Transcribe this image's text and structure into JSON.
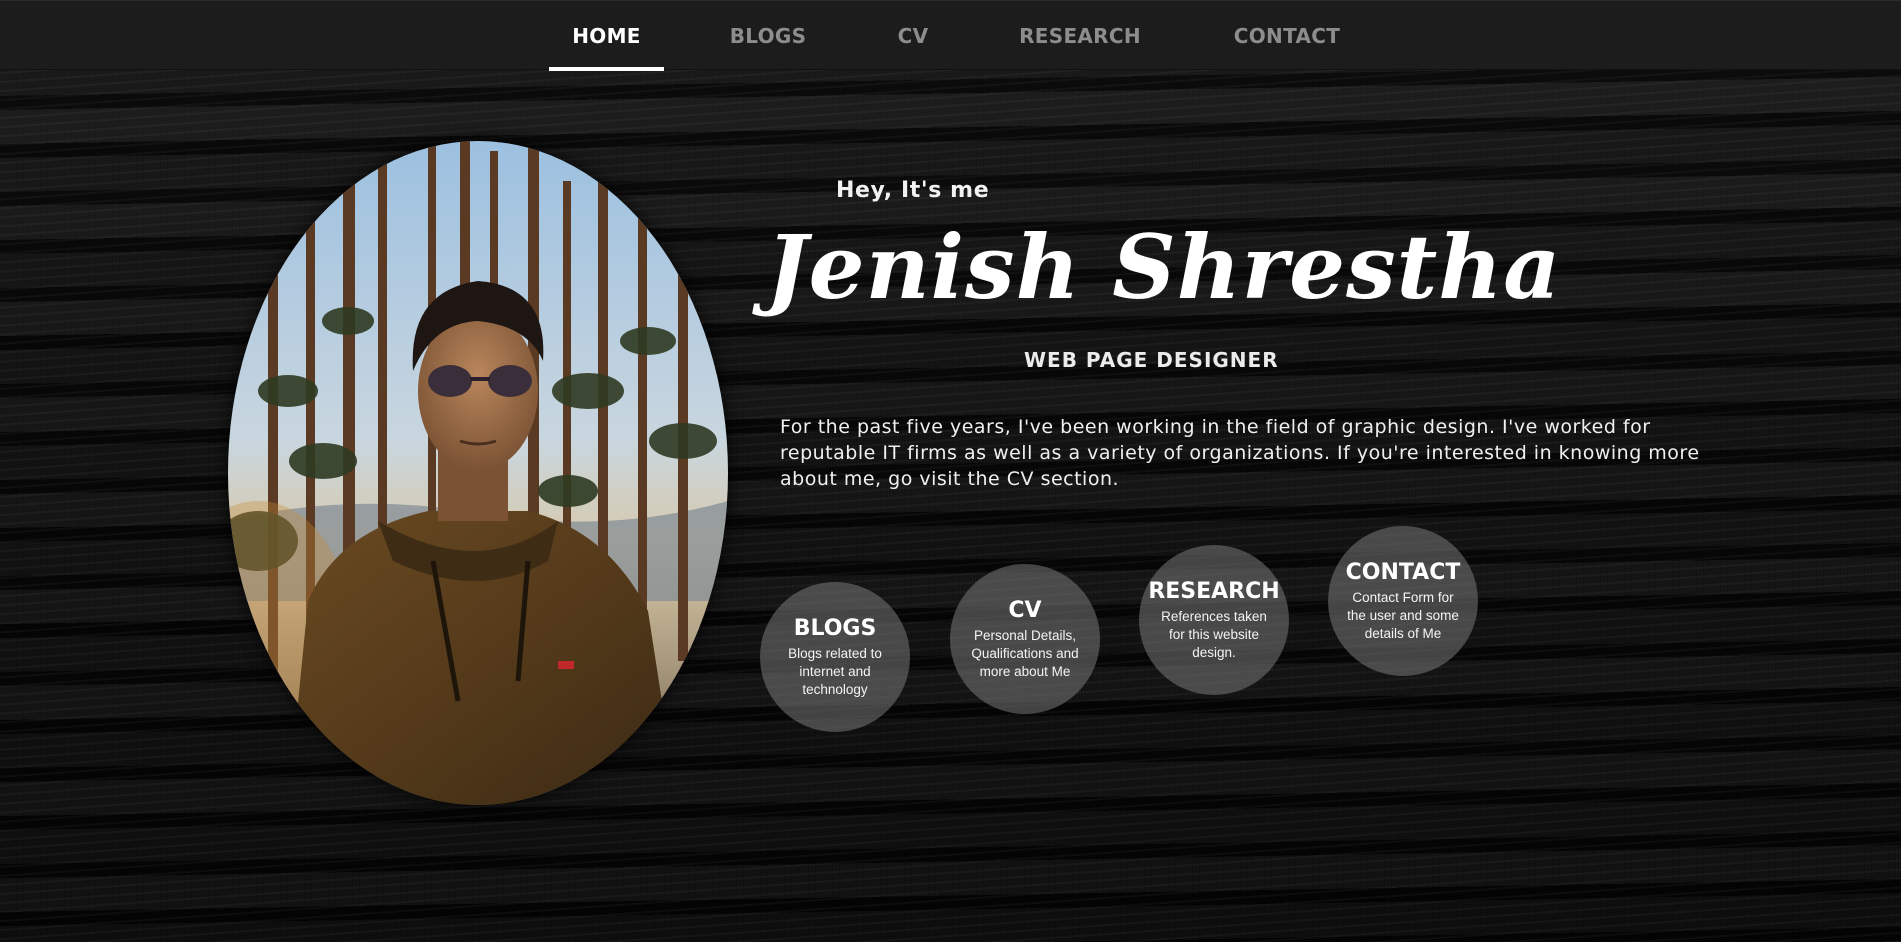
{
  "nav": {
    "items": [
      {
        "label": "HOME",
        "active": true
      },
      {
        "label": "BLOGS",
        "active": false
      },
      {
        "label": "CV",
        "active": false
      },
      {
        "label": "RESEARCH",
        "active": false
      },
      {
        "label": "CONTACT",
        "active": false
      }
    ]
  },
  "hero": {
    "greeting": "Hey, It's me",
    "name": "Jenish Shrestha",
    "role": "WEB PAGE DESIGNER",
    "bio": "For the past five years, I've been working in the field of graphic design. I've worked for reputable IT firms as well as a variety of organizations. If you're interested in knowing more about me, go visit the CV section."
  },
  "sections": [
    {
      "title": "BLOGS",
      "description": "Blogs related to internet and technology"
    },
    {
      "title": "CV",
      "description": "Personal Details, Qualifications and more about Me"
    },
    {
      "title": "RESEARCH",
      "description": "References taken for this website design."
    },
    {
      "title": "CONTACT",
      "description": "Contact Form for the user and some details of Me"
    }
  ],
  "colors": {
    "navbar_bg": "#1c1c1c",
    "nav_active": "#ffffff",
    "nav_inactive": "#8d8d8d",
    "circle_bg": "rgba(120,120,120,0.55)"
  }
}
